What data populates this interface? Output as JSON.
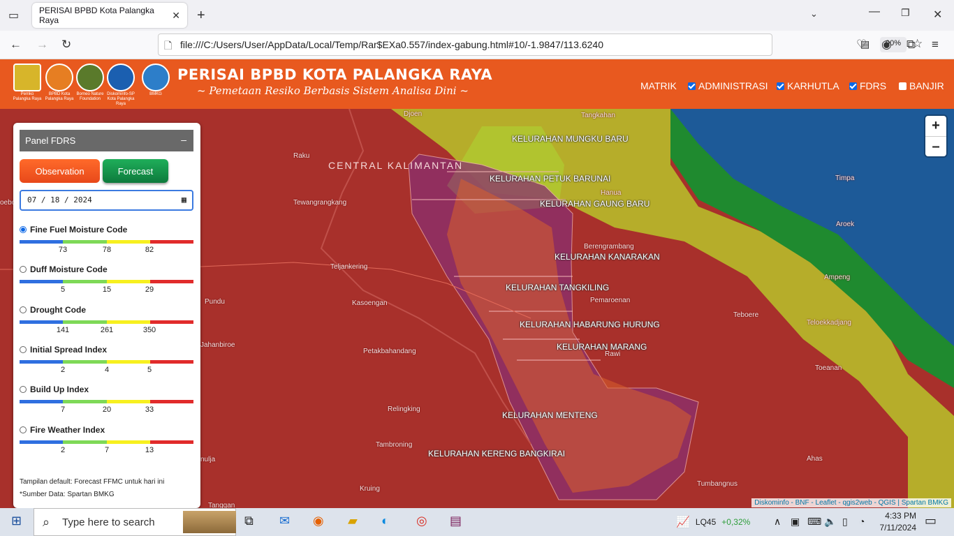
{
  "browser": {
    "tab_title": "PERISAI BPBD Kota Palangka Raya",
    "url": "file:///C:/Users/User/AppData/Local/Temp/Rar$EXa0.557/index-gabung.html#10/-1.9847/113.6240",
    "zoom": "90%"
  },
  "header": {
    "title": "PERISAI BPBD KOTA PALANGKA RAYA",
    "subtitle": "~ Pemetaan Resiko Berbasis Sistem Analisa Dini ~",
    "logos": [
      {
        "caption": "Pemko Palangka Raya",
        "color": "#d7b52a"
      },
      {
        "caption": "BPBD Kota Palangka Raya",
        "color": "#e67e22"
      },
      {
        "caption": "Borneo Nature Foundation",
        "color": "#5a7a2b"
      },
      {
        "caption": "Diskominfo-SP Kota Palangka Raya",
        "color": "#1b5fb0"
      },
      {
        "caption": "BMKG",
        "color": "#2d7ec9"
      }
    ],
    "menu": {
      "matrik": "MATRIK",
      "administrasi": "ADMINISTRASI",
      "karhutla": "KARHUTLA",
      "fdrs": "FDRS",
      "banjir": "BANJIR"
    }
  },
  "panel": {
    "title": "Panel FDRS",
    "collapse_symbol": "–",
    "observation_label": "Observation",
    "forecast_label": "Forecast",
    "date_value": "07 / 18 / 2024",
    "indices": [
      {
        "name": "Fine Fuel Moisture Code",
        "selected": true,
        "ticks": [
          "73",
          "78",
          "82"
        ]
      },
      {
        "name": "Duff Moisture Code",
        "selected": false,
        "ticks": [
          "5",
          "15",
          "29"
        ]
      },
      {
        "name": "Drought Code",
        "selected": false,
        "ticks": [
          "141",
          "261",
          "350"
        ]
      },
      {
        "name": "Initial Spread Index",
        "selected": false,
        "ticks": [
          "2",
          "4",
          "5"
        ]
      },
      {
        "name": "Build Up Index",
        "selected": false,
        "ticks": [
          "7",
          "20",
          "33"
        ]
      },
      {
        "name": "Fire Weather Index",
        "selected": false,
        "ticks": [
          "2",
          "7",
          "13"
        ]
      }
    ],
    "scale_colors": [
      "#2f6fe0",
      "#7ed957",
      "#f7f01f",
      "#e12b2b"
    ],
    "note_default": "Tampilan default: Forecast FFMC untuk hari ini",
    "note_source": "*Sumber Data: Spartan BMKG"
  },
  "map": {
    "region_label": "CENTRAL KALIMANTAN",
    "kelurahan": [
      "KELURAHAN MUNGKU BARU",
      "KELURAHAN PETUK BARUNAI",
      "KELURAHAN GAUNG BARU",
      "KELURAHAN KANARAKAN",
      "KELURAHAN TANGKILING",
      "KELURAHAN HABARUNG HURUNG",
      "KELURAHAN MARANG",
      "KELURAHAN MENTENG",
      "KELURAHAN KERENG BANGKIRAI"
    ],
    "places": [
      "Djoen",
      "Tangkahan",
      "Raku",
      "Tewangrangkang",
      "Hanua",
      "Timpa",
      "Aroek",
      "Berengrambang",
      "Teljankering",
      "Ampeng",
      "Pundu",
      "Kasoengan",
      "Pemaroenan",
      "Teboere",
      "Teloekkadjang",
      "Jahanbiroe",
      "Petakbahandang",
      "Rawi",
      "Toeanan",
      "Relingking",
      "Tambroning",
      "Ahas",
      "nulja",
      "Kruing",
      "Tumbangnus",
      "Tanggan",
      "oebo"
    ],
    "zoom_in": "+",
    "zoom_out": "–",
    "attribution": "Diskominfo - BNF - Leaflet - qgis2web - QGIS | Spartan BMKG"
  },
  "taskbar": {
    "search_placeholder": "Type here to search",
    "stock_name": "LQ45",
    "stock_change": "+0,32%",
    "time": "4:33 PM",
    "date": "7/11/2024"
  }
}
